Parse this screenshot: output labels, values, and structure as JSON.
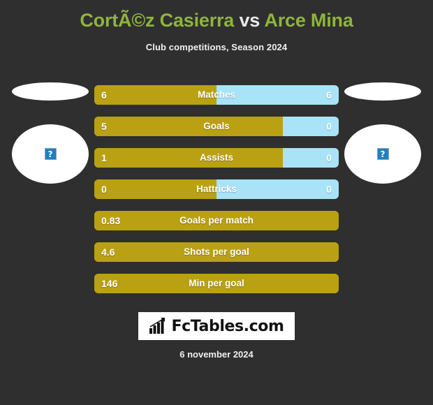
{
  "header": {
    "player_home": "CortÃ©z Casierra",
    "versus": "vs",
    "player_away": "Arce Mina",
    "subtitle": "Club competitions, Season 2024"
  },
  "players": {
    "home_photo_placeholder": "?",
    "away_photo_placeholder": "?"
  },
  "colors": {
    "background": "#2f2f2f",
    "home_bar": "#b9a113",
    "away_bar": "#a8e3f7",
    "title_name": "#8fb43c",
    "title_vs": "#e9e9e9",
    "text": "#ffffff"
  },
  "chart_data": {
    "type": "bar",
    "title": "CortÃ©z Casierra vs Arce Mina",
    "subtitle": "Club competitions, Season 2024",
    "orientation": "horizontal-diverging",
    "series": [
      {
        "name": "CortÃ©z Casierra",
        "color": "#b9a113",
        "values": [
          6,
          5,
          1,
          0,
          0.83,
          4.6,
          146
        ]
      },
      {
        "name": "Arce Mina",
        "color": "#a8e3f7",
        "values": [
          6,
          0,
          0,
          0,
          null,
          null,
          null
        ]
      }
    ],
    "categories": [
      "Matches",
      "Goals",
      "Assists",
      "Hattricks",
      "Goals per match",
      "Shots per goal",
      "Min per goal"
    ],
    "rows": [
      {
        "label": "Matches",
        "home_value": "6",
        "away_value": "6",
        "home_pct": 50,
        "has_away": true
      },
      {
        "label": "Goals",
        "home_value": "5",
        "away_value": "0",
        "home_pct": 77,
        "has_away": true
      },
      {
        "label": "Assists",
        "home_value": "1",
        "away_value": "0",
        "home_pct": 77,
        "has_away": true
      },
      {
        "label": "Hattricks",
        "home_value": "0",
        "away_value": "0",
        "home_pct": 50,
        "has_away": true
      },
      {
        "label": "Goals per match",
        "home_value": "0.83",
        "away_value": "",
        "home_pct": 100,
        "has_away": false
      },
      {
        "label": "Shots per goal",
        "home_value": "4.6",
        "away_value": "",
        "home_pct": 100,
        "has_away": false
      },
      {
        "label": "Min per goal",
        "home_value": "146",
        "away_value": "",
        "home_pct": 100,
        "has_away": false
      }
    ],
    "grid": false,
    "legend": "none"
  },
  "footer": {
    "logo_text": "FcTables.com",
    "logo_icon": "bar-chart-arrow-icon",
    "date": "6 november 2024"
  }
}
